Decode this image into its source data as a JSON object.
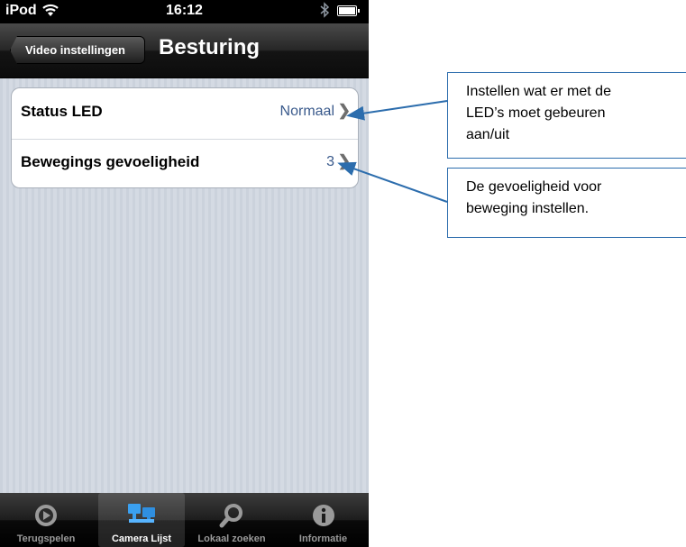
{
  "statusbar": {
    "carrier": "iPod",
    "time": "16:12"
  },
  "navbar": {
    "back_label": "Video instellingen",
    "title": "Besturing"
  },
  "settings": {
    "rows": [
      {
        "label": "Status LED",
        "value": "Normaal"
      },
      {
        "label": "Bewegings gevoeligheid",
        "value": "3"
      }
    ]
  },
  "tabbar": {
    "tabs": [
      {
        "label": "Terugspelen",
        "icon": "playback-icon",
        "selected": false
      },
      {
        "label": "Camera Lijst",
        "icon": "camera-list-icon",
        "selected": true
      },
      {
        "label": "Lokaal zoeken",
        "icon": "search-icon",
        "selected": false
      },
      {
        "label": "Informatie",
        "icon": "info-icon",
        "selected": false
      }
    ]
  },
  "annotations": {
    "callout1": {
      "lines": [
        "Instellen wat er met de",
        "LED’s moet gebeuren",
        "aan/uit"
      ]
    },
    "callout2": {
      "lines": [
        "De gevoeligheid voor",
        "beweging instellen."
      ]
    }
  },
  "colors": {
    "callout_border": "#2c6dad",
    "row_value": "#3a5a8c",
    "navbar": "#1a1a1a"
  }
}
